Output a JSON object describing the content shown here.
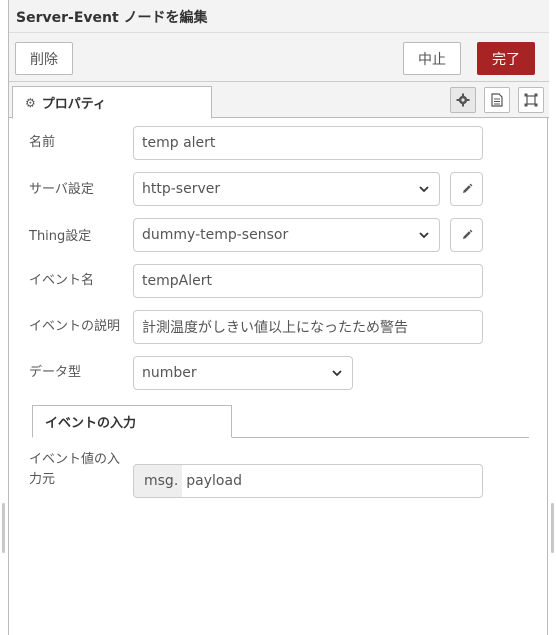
{
  "dialog": {
    "title": "Server-Event ノードを編集",
    "delete_label": "削除",
    "cancel_label": "中止",
    "done_label": "完了"
  },
  "tabs": {
    "properties_label": "プロパティ",
    "icons": [
      "gear-icon",
      "document-icon",
      "frame-icon"
    ]
  },
  "form": {
    "name_label": "名前",
    "name_value": "temp alert",
    "server_label": "サーバ設定",
    "server_value": "http-server",
    "thing_label": "Thing設定",
    "thing_value": "dummy-temp-sensor",
    "event_name_label": "イベント名",
    "event_name_value": "tempAlert",
    "event_desc_label": "イベントの説明",
    "event_desc_value": "計測温度がしきい値以上になったため警告",
    "datatype_label": "データ型",
    "datatype_value": "number"
  },
  "input_section": {
    "tab_label": "イベントの入力",
    "value_label_line1": "イベント値の入",
    "value_label_line2": "力元",
    "value_prefix": "msg.",
    "value": "payload"
  },
  "colors": {
    "accent": "#a82424",
    "border": "#cccccc",
    "header_bg": "#f3f3f3"
  }
}
